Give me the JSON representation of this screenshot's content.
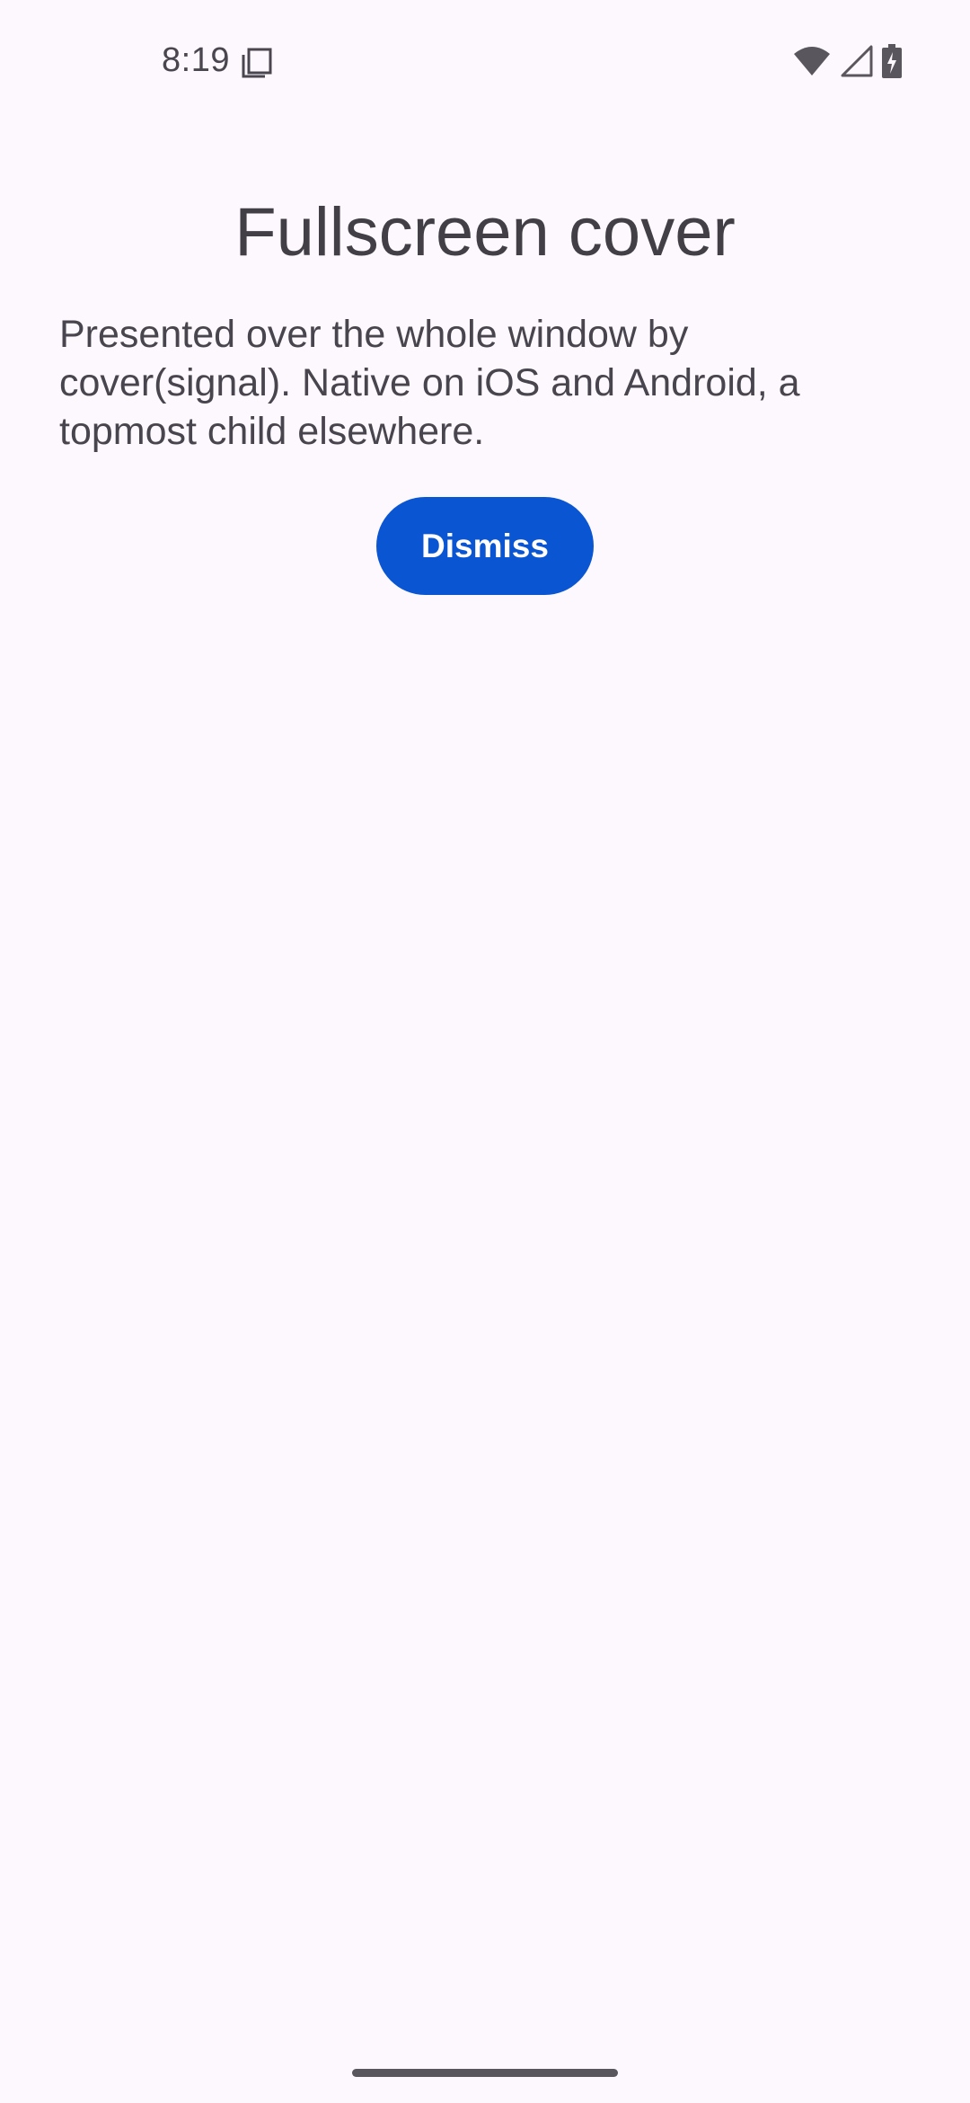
{
  "status_bar": {
    "time": "8:19",
    "icons": [
      "notification-icon",
      "wifi-icon",
      "cellular-signal-icon",
      "battery-charging-icon"
    ]
  },
  "page": {
    "title": "Fullscreen cover",
    "description": "Presented over the whole window by cover(signal). Native on iOS and Android, a topmost child elsewhere.",
    "dismiss_label": "Dismiss"
  },
  "colors": {
    "background": "#fdf8fd",
    "accent": "#0a55d2",
    "text_primary": "#433f47",
    "text_secondary": "#49454e"
  }
}
